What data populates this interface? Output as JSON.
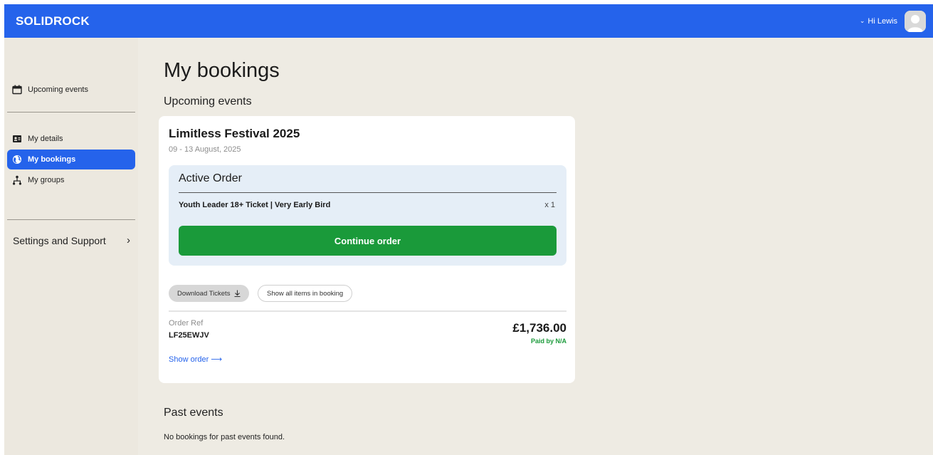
{
  "header": {
    "brand": "SOLIDROCK",
    "greeting": "Hi Lewis",
    "accent_color": "#2563eb"
  },
  "sidebar": {
    "top_item": {
      "label": "Upcoming events",
      "icon": "calendar-icon"
    },
    "items": [
      {
        "label": "My details",
        "icon": "id-card-icon",
        "active": false
      },
      {
        "label": "My bookings",
        "icon": "globe-icon",
        "active": true
      },
      {
        "label": "My groups",
        "icon": "org-chart-icon",
        "active": false
      }
    ],
    "settings_label": "Settings and Support"
  },
  "main": {
    "title": "My bookings",
    "upcoming_title": "Upcoming events",
    "booking": {
      "event_name": "Limitless Festival 2025",
      "dates": "09 - 13 August, 2025",
      "active_order": {
        "title": "Active Order",
        "ticket_name": "Youth Leader 18+ Ticket | Very Early Bird",
        "quantity": "x 1",
        "continue_label": "Continue order"
      },
      "download_label": "Download Tickets",
      "show_all_label": "Show all items in booking",
      "order_ref_label": "Order Ref",
      "order_ref": "LF25EWJV",
      "amount": "£1,736.00",
      "paid_by": "Paid by N/A",
      "show_order_label": "Show order"
    },
    "past_title": "Past events",
    "past_empty": "No bookings for past events found."
  }
}
